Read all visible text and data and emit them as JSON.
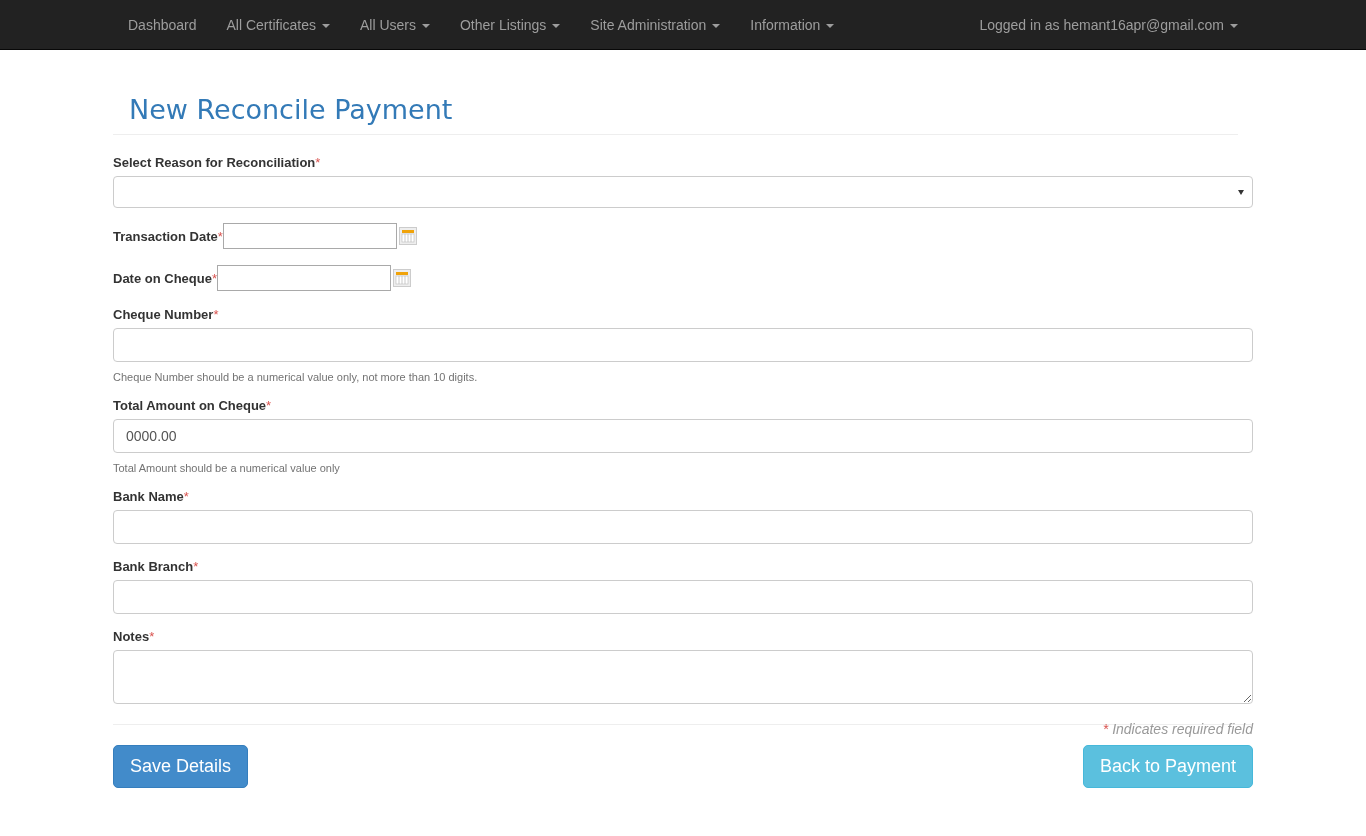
{
  "navbar": {
    "items": [
      {
        "label": "Dashboard",
        "dropdown": false
      },
      {
        "label": "All Certificates",
        "dropdown": true
      },
      {
        "label": "All Users",
        "dropdown": true
      },
      {
        "label": "Other Listings",
        "dropdown": true
      },
      {
        "label": "Site Administration",
        "dropdown": true
      },
      {
        "label": "Information",
        "dropdown": true
      }
    ],
    "user": {
      "label": "Logged in as hemant16apr@gmail.com",
      "dropdown": true
    }
  },
  "title": "New Reconcile Payment",
  "fields": [
    {
      "kind": "select",
      "label": "Select Reason for Reconciliation",
      "mark": "*"
    },
    {
      "kind": "date",
      "label": "Transaction Date",
      "mark": "*"
    },
    {
      "kind": "date",
      "label": "Date on Cheque",
      "mark": "*"
    },
    {
      "kind": "text",
      "label": "Cheque Number",
      "mark": "*",
      "help": "Cheque Number should be a numerical value only, not more than 10 digits."
    },
    {
      "kind": "text",
      "label": "Total Amount on Cheque",
      "mark": "*",
      "value": "0000.00",
      "help": "Total Amount should be a numerical value only"
    },
    {
      "kind": "text",
      "label": "Bank Name",
      "mark": "*"
    },
    {
      "kind": "text",
      "label": "Bank Branch",
      "mark": "*"
    },
    {
      "kind": "textarea",
      "label": "Notes",
      "mark": "*"
    }
  ],
  "required_note": {
    "mark": "*",
    "text": "Indicates required field"
  },
  "buttons": [
    {
      "label": "Save Details",
      "kind": "primary"
    },
    {
      "label": "Back to Payment",
      "kind": "info"
    }
  ]
}
